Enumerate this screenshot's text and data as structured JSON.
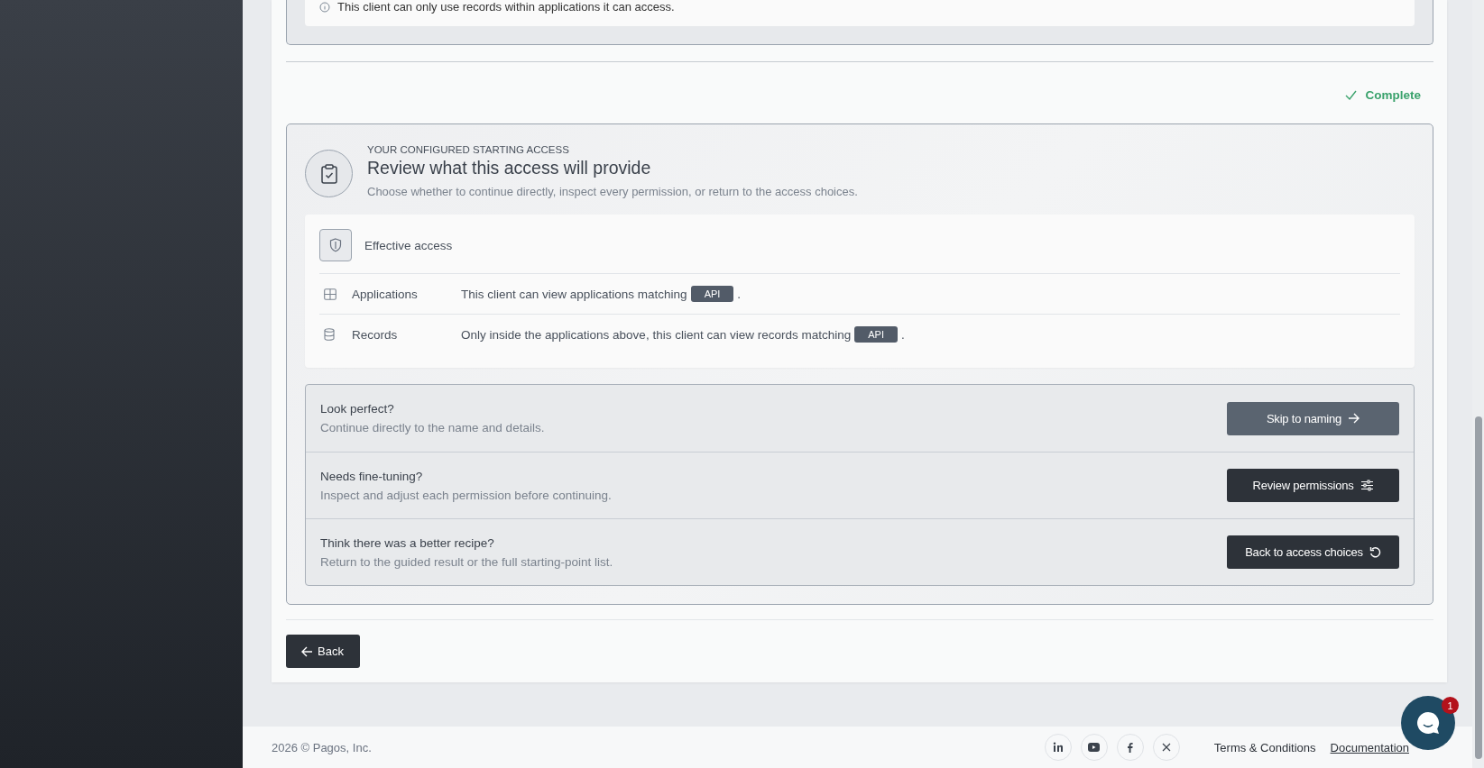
{
  "notice": {
    "text": "This client can only use records within applications it can access."
  },
  "status": {
    "label": "Complete",
    "complete": true
  },
  "review": {
    "eyebrow": "YOUR CONFIGURED STARTING ACCESS",
    "title": "Review what this access will provide",
    "subtitle": "Choose whether to continue directly, inspect every permission, or return to the access choices.",
    "effective_access": {
      "title": "Effective access",
      "rows": [
        {
          "kind": "applications",
          "label": "Applications",
          "text": "This client can view applications matching",
          "tag": "API",
          "suffix": "."
        },
        {
          "kind": "records",
          "label": "Records",
          "text": "Only inside the applications above, this client can view records matching",
          "tag": "API",
          "suffix": "."
        }
      ]
    },
    "actions": [
      {
        "kind": "skip",
        "question": "Look perfect?",
        "description": "Continue directly to the name and details.",
        "button": "Skip to naming"
      },
      {
        "kind": "review",
        "question": "Needs fine-tuning?",
        "description": "Inspect and adjust each permission before continuing.",
        "button": "Review permissions"
      },
      {
        "kind": "restart",
        "question": "Think there was a better recipe?",
        "description": "Return to the guided result or the full starting-point list.",
        "button": "Back to access choices"
      }
    ]
  },
  "back_button": "Back",
  "footer": {
    "copyright": "2026 © Pagos, Inc.",
    "links": [
      "Terms & Conditions",
      "Documentation"
    ]
  },
  "chat": {
    "badge": "1"
  }
}
